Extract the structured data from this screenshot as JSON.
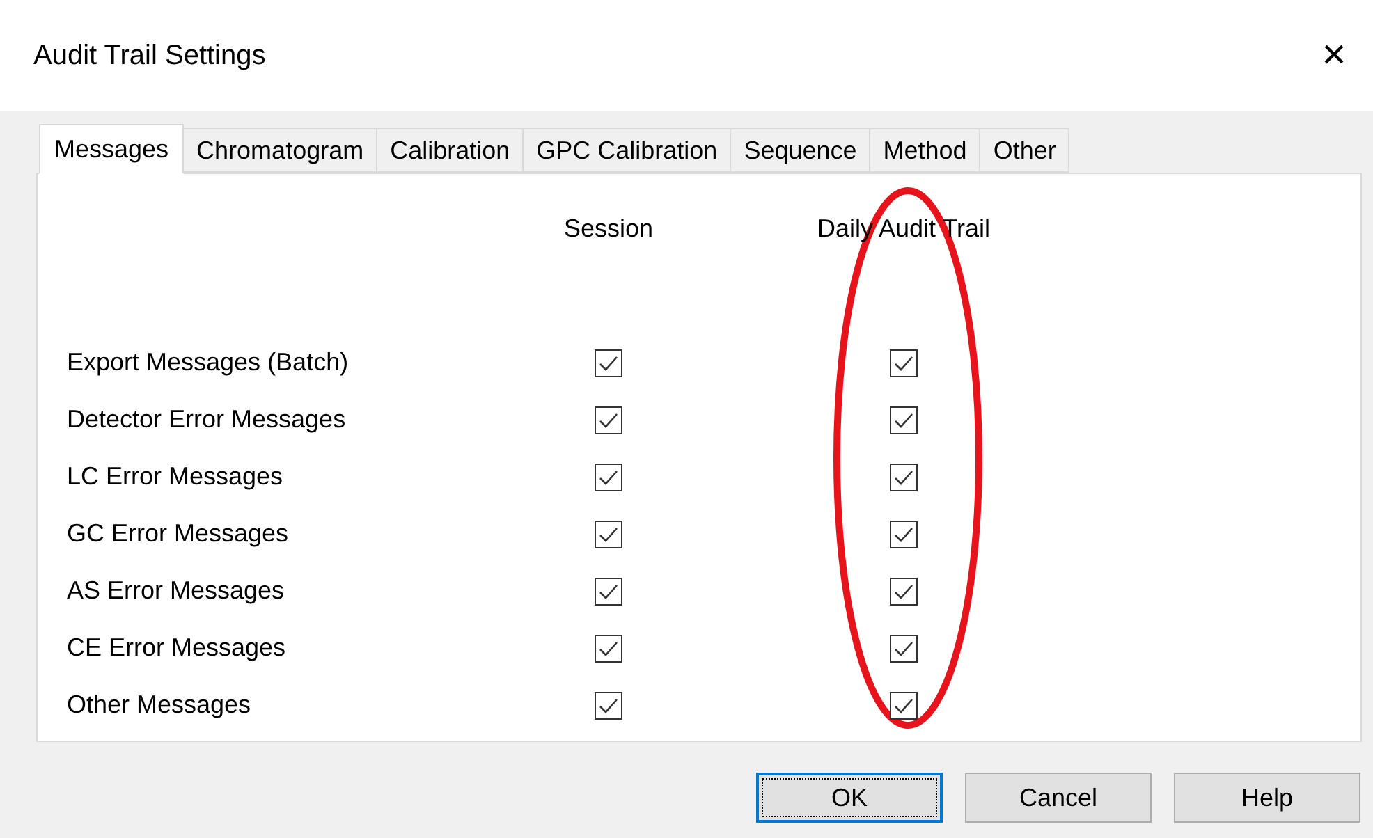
{
  "window": {
    "title": "Audit Trail Settings",
    "close": "×"
  },
  "tabs": [
    {
      "label": "Messages",
      "selected": true
    },
    {
      "label": "Chromatogram",
      "selected": false
    },
    {
      "label": "Calibration",
      "selected": false
    },
    {
      "label": "GPC Calibration",
      "selected": false
    },
    {
      "label": "Sequence",
      "selected": false
    },
    {
      "label": "Method",
      "selected": false
    },
    {
      "label": "Other",
      "selected": false
    }
  ],
  "columns": [
    "Session",
    "Daily Audit Trail"
  ],
  "rows": [
    {
      "label": "Export Messages (Batch)",
      "session": true,
      "daily": true
    },
    {
      "label": "Detector Error Messages",
      "session": true,
      "daily": true
    },
    {
      "label": "LC Error Messages",
      "session": true,
      "daily": true
    },
    {
      "label": "GC Error Messages",
      "session": true,
      "daily": true
    },
    {
      "label": "AS Error Messages",
      "session": true,
      "daily": true
    },
    {
      "label": "CE Error Messages",
      "session": true,
      "daily": true
    },
    {
      "label": "Other Messages",
      "session": true,
      "daily": true
    }
  ],
  "highlight": {
    "kind": "ellipse"
  },
  "buttons": [
    {
      "label": "OK",
      "focused": true
    },
    {
      "label": "Cancel",
      "focused": false
    },
    {
      "label": "Help",
      "focused": false
    }
  ]
}
